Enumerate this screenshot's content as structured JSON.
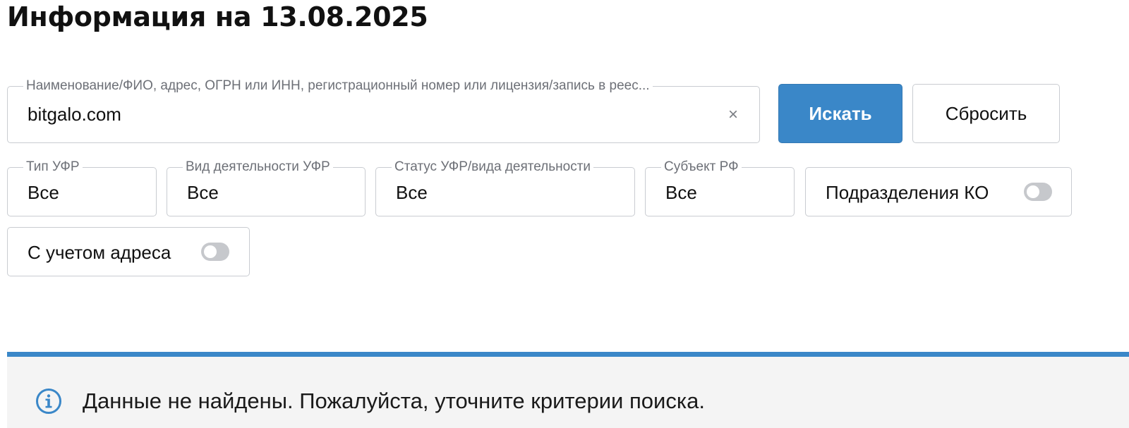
{
  "header": {
    "title": "Информация на 13.08.2025"
  },
  "search": {
    "label": "Наименование/ФИО, адрес, ОГРН или ИНН, регистрационный номер или лицензия/запись в реес...",
    "value": "bitgalo.com",
    "clear_icon": "×"
  },
  "buttons": {
    "search_label": "Искать",
    "reset_label": "Сбросить"
  },
  "filters": [
    {
      "label": "Тип УФР",
      "value": "Все"
    },
    {
      "label": "Вид деятельности УФР",
      "value": "Все"
    },
    {
      "label": "Статус УФР/вида деятельности",
      "value": "Все"
    },
    {
      "label": "Субъект РФ",
      "value": "Все"
    }
  ],
  "toggles": [
    {
      "label": "Подразделения КО",
      "checked": false
    },
    {
      "label": "С учетом адреса",
      "checked": false
    }
  ],
  "notice": {
    "icon": "info-icon",
    "text": "Данные не найдены. Пожалуйста, уточните критерии поиска."
  },
  "colors": {
    "accent": "#3a87c8",
    "border": "#c9ccd1",
    "notice_bg": "#f4f4f4",
    "switch_off": "#c6c8cc"
  }
}
